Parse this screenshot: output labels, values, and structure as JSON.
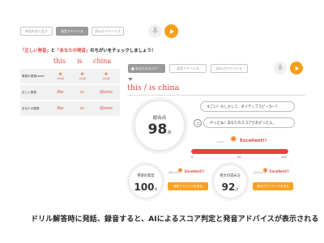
{
  "top_left": {
    "tabs": [
      "単語を見て話す",
      "発音アドバイス",
      "読み方アドバイス"
    ],
    "active_tab": 1
  },
  "instruction": {
    "quote1": "「正しい発音」",
    "middle": "と",
    "quote2": "「あなたの発音」",
    "rest": "のちがいをチェックしましょう！"
  },
  "words": [
    "this",
    "is",
    "china"
  ],
  "table": {
    "rows": [
      {
        "label": "単語の発音Level",
        "cells": [
          {
            "icon": "sun-icon",
            "score": "100点"
          },
          {
            "icon": "sun-icon",
            "score": "100点"
          },
          {
            "icon": "sun-icon",
            "score": "100点"
          }
        ]
      },
      {
        "label": "正しい発音",
        "cells": [
          "ðɪs",
          "ɪz",
          "tʃaɪnə"
        ]
      },
      {
        "label": "あなたの発音",
        "cells": [
          "ðɪs",
          "ɪz",
          "tʃaɪnə"
        ]
      }
    ]
  },
  "right": {
    "tabs": [
      "あなたのスコア",
      "発音アドバイス",
      "読み方アドバイス"
    ],
    "sentence": "this  / is china",
    "total_label": "総合点",
    "total_score": "98",
    "total_unit": "点",
    "bubble1": "すごい！もしかして、ネイティブスピーカー？",
    "bubble2": "やったね！あなたのスコアがあがったよ。",
    "level_label": "Level",
    "excellent": "Excellent!!",
    "scale": [
      "0",
      "50",
      "100"
    ],
    "level_fraction": 1.0,
    "colors": {
      "accent": "#e0443c",
      "orange": "#f7a224"
    },
    "word_label": "単語の発音",
    "word_score": "100",
    "word_unit": "点",
    "word_level_label": "発音Level",
    "word_excellent": "Excellent!!",
    "word_btn": "発音アドバイスを見る",
    "fluency_label": "英文の読み方",
    "fluency_score": "92",
    "fluency_unit": "点",
    "fluency_level_label": "読み方Level",
    "fluency_excellent": "Excellent!!",
    "fluency_btn": "読み方アドバイスを見る"
  },
  "caption": "ドリル解答時に発話、録音すると、AIによるスコア判定と発音アドバイスが表示される"
}
